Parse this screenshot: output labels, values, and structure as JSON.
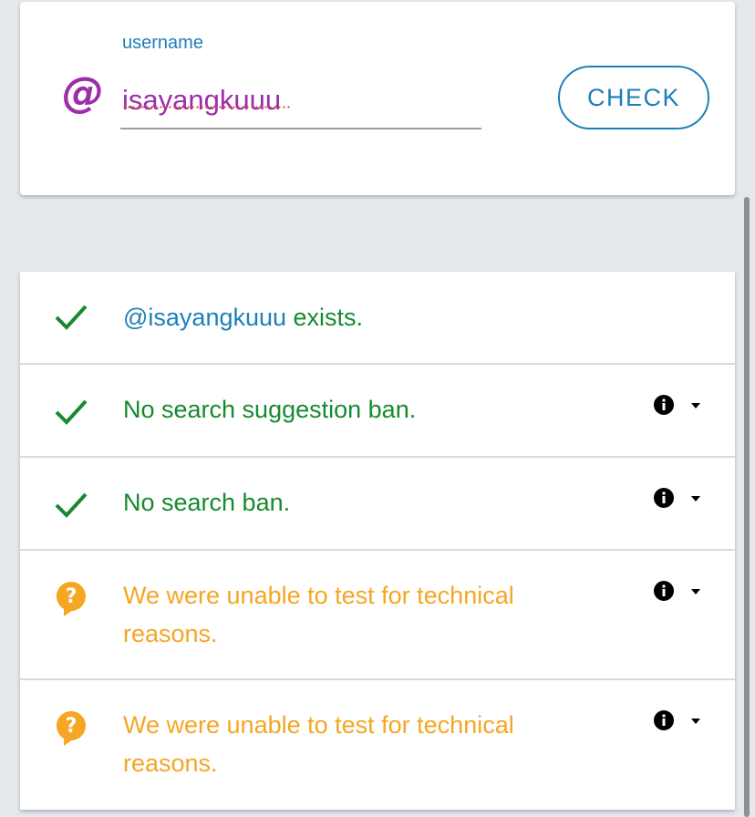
{
  "search": {
    "label": "username",
    "at_symbol": "@",
    "value": "isayangkuuu",
    "button": "CHECK"
  },
  "results": [
    {
      "status": "ok",
      "icon": "check-icon",
      "handle": "@isayangkuuu",
      "text": " exists.",
      "has_details": false
    },
    {
      "status": "ok",
      "icon": "check-icon",
      "text": "No search suggestion ban.",
      "has_details": true
    },
    {
      "status": "ok",
      "icon": "check-icon",
      "text": "No search ban.",
      "has_details": true
    },
    {
      "status": "unknown",
      "icon": "question-bubble-icon",
      "text": "We were unable to test for technical reasons.",
      "has_details": true
    },
    {
      "status": "unknown",
      "icon": "question-bubble-icon",
      "text": "We were unable to test for technical reasons.",
      "has_details": true
    }
  ],
  "colors": {
    "accent": "#1e7fb8",
    "username": "#9c2fa8",
    "ok": "#168a2e",
    "unknown": "#f5a623",
    "background": "#e4e9ee"
  }
}
